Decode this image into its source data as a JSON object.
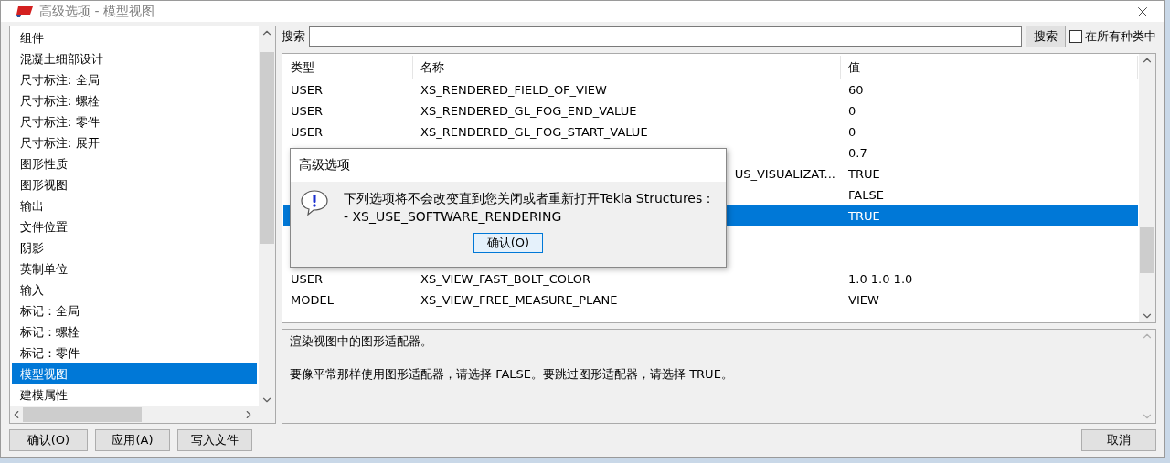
{
  "window": {
    "title": "高级选项 - 模型视图"
  },
  "categories": [
    {
      "label": "组件",
      "selected": false
    },
    {
      "label": "混凝土细部设计",
      "selected": false
    },
    {
      "label": "尺寸标注: 全局",
      "selected": false
    },
    {
      "label": "尺寸标注: 螺栓",
      "selected": false
    },
    {
      "label": "尺寸标注: 零件",
      "selected": false
    },
    {
      "label": "尺寸标注: 展开",
      "selected": false
    },
    {
      "label": "图形性质",
      "selected": false
    },
    {
      "label": "图形视图",
      "selected": false
    },
    {
      "label": "输出",
      "selected": false
    },
    {
      "label": "文件位置",
      "selected": false
    },
    {
      "label": "阴影",
      "selected": false
    },
    {
      "label": "英制单位",
      "selected": false
    },
    {
      "label": "输入",
      "selected": false
    },
    {
      "label": "标记：全局",
      "selected": false
    },
    {
      "label": "标记：螺栓",
      "selected": false
    },
    {
      "label": "标记：零件",
      "selected": false
    },
    {
      "label": "模型视图",
      "selected": true
    },
    {
      "label": "建模属性",
      "selected": false
    }
  ],
  "search": {
    "label": "搜索",
    "button": "搜索",
    "all_categories": {
      "label": "在所有种类中",
      "checked": false
    }
  },
  "table": {
    "columns": [
      "类型",
      "名称",
      "值"
    ],
    "rows": [
      {
        "type": "USER",
        "name": "XS_RENDERED_FIELD_OF_VIEW",
        "value": "60",
        "selected": false
      },
      {
        "type": "USER",
        "name": "XS_RENDERED_GL_FOG_END_VALUE",
        "value": "0",
        "selected": false
      },
      {
        "type": "USER",
        "name": "XS_RENDERED_GL_FOG_START_VALUE",
        "value": "0",
        "selected": false
      },
      {
        "value": "0.7",
        "selected": false
      },
      {
        "name": "US_VISUALIZAT...",
        "value": "TRUE",
        "selected": false,
        "kind": "covered"
      },
      {
        "value": "FALSE",
        "selected": false
      },
      {
        "value": "TRUE",
        "selected": true
      },
      {
        "selected": false
      },
      {
        "selected": false
      },
      {
        "type": "USER",
        "name": "XS_VIEW_FAST_BOLT_COLOR",
        "value": "1.0 1.0 1.0",
        "selected": false
      },
      {
        "type": "MODEL",
        "name": "XS_VIEW_FREE_MEASURE_PLANE",
        "value": "VIEW",
        "selected": false
      }
    ]
  },
  "description": [
    "渲染视图中的图形适配器。",
    "要像平常那样使用图形适配器，请选择 FALSE。要跳过图形适配器，请选择 TRUE。"
  ],
  "buttons": {
    "ok": "确认(O)",
    "apply": "应用(A)",
    "write": "写入文件",
    "cancel": "取消"
  },
  "dialog": {
    "title": "高级选项",
    "message": "下列选项将不会改变直到您关闭或者重新打开Tekla Structures：",
    "item": "- XS_USE_SOFTWARE_RENDERING",
    "button": "确认(O)"
  }
}
